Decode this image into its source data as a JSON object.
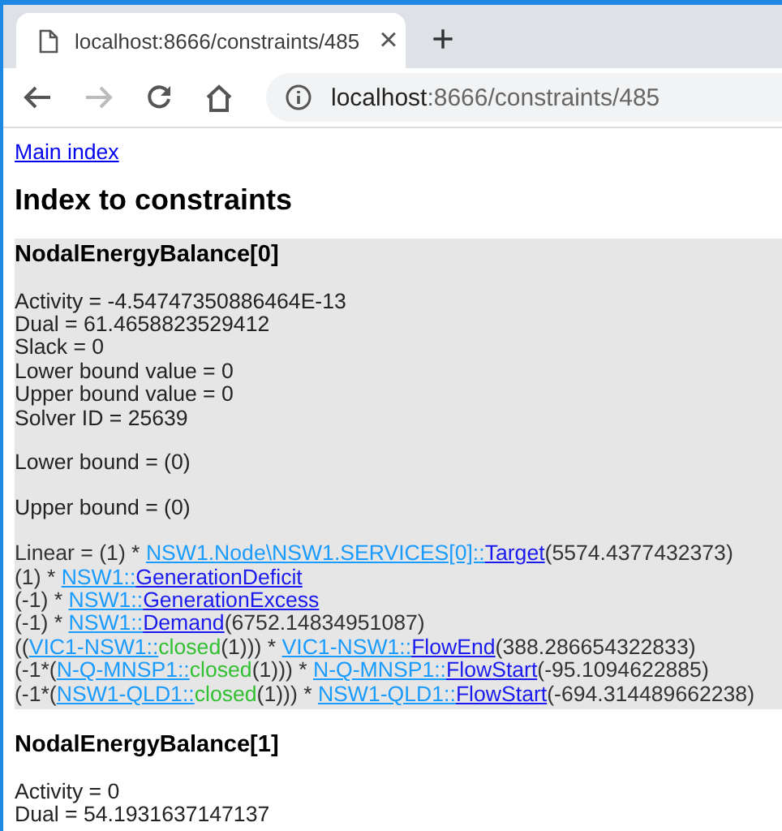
{
  "browser": {
    "tab": {
      "title": "localhost:8666/constraints/485",
      "close": "×"
    },
    "new_tab": "+",
    "address": {
      "host": "localhost",
      "path": ":8666/constraints/485"
    }
  },
  "page": {
    "main_link": "Main index",
    "heading": "Index to constraints",
    "constraints": [
      {
        "title": "NodalEnergyBalance[0]",
        "highlighted": true,
        "properties": [
          "Activity = -4.54747350886464E-13",
          "Dual = 61.4658823529412",
          "Slack = 0",
          "Lower bound value = 0",
          "Upper bound value = 0",
          "Solver ID = 25639"
        ],
        "bounds": [
          "Lower bound = (0)",
          "Upper bound = (0)"
        ],
        "linear": [
          [
            {
              "kind": "text",
              "text": "Linear = (1) * "
            },
            {
              "kind": "scope",
              "text": "NSW1.Node\\NSW1.SERVICES[0]::"
            },
            {
              "kind": "name",
              "text": "Target"
            },
            {
              "kind": "text",
              "text": "(5574.4377432373)"
            }
          ],
          [
            {
              "kind": "text",
              "text": "(1) * "
            },
            {
              "kind": "scope",
              "text": "NSW1::"
            },
            {
              "kind": "name",
              "text": "GenerationDeficit"
            }
          ],
          [
            {
              "kind": "text",
              "text": "(-1) * "
            },
            {
              "kind": "scope",
              "text": "NSW1::"
            },
            {
              "kind": "name",
              "text": "GenerationExcess"
            }
          ],
          [
            {
              "kind": "text",
              "text": "(-1) * "
            },
            {
              "kind": "scope",
              "text": "NSW1::"
            },
            {
              "kind": "name",
              "text": "Demand"
            },
            {
              "kind": "text",
              "text": "(6752.14834951087)"
            }
          ],
          [
            {
              "kind": "text",
              "text": "(("
            },
            {
              "kind": "scope",
              "text": "VIC1-NSW1::"
            },
            {
              "kind": "flag",
              "text": "closed"
            },
            {
              "kind": "text",
              "text": "(1))) * "
            },
            {
              "kind": "scope",
              "text": "VIC1-NSW1::"
            },
            {
              "kind": "name",
              "text": "FlowEnd"
            },
            {
              "kind": "text",
              "text": "(388.286654322833)"
            }
          ],
          [
            {
              "kind": "text",
              "text": "(-1*("
            },
            {
              "kind": "scope",
              "text": "N-Q-MNSP1::"
            },
            {
              "kind": "flag",
              "text": "closed"
            },
            {
              "kind": "text",
              "text": "(1))) * "
            },
            {
              "kind": "scope",
              "text": "N-Q-MNSP1::"
            },
            {
              "kind": "name",
              "text": "FlowStart"
            },
            {
              "kind": "text",
              "text": "(-95.1094622885)"
            }
          ],
          [
            {
              "kind": "text",
              "text": "(-1*("
            },
            {
              "kind": "scope",
              "text": "NSW1-QLD1::"
            },
            {
              "kind": "flag",
              "text": "closed"
            },
            {
              "kind": "text",
              "text": "(1))) * "
            },
            {
              "kind": "scope",
              "text": "NSW1-QLD1::"
            },
            {
              "kind": "name",
              "text": "FlowStart"
            },
            {
              "kind": "text",
              "text": "(-694.314489662238)"
            }
          ]
        ]
      },
      {
        "title": "NodalEnergyBalance[1]",
        "highlighted": false,
        "properties": [
          "Activity = 0",
          "Dual = 54.1931637147137"
        ]
      }
    ]
  }
}
